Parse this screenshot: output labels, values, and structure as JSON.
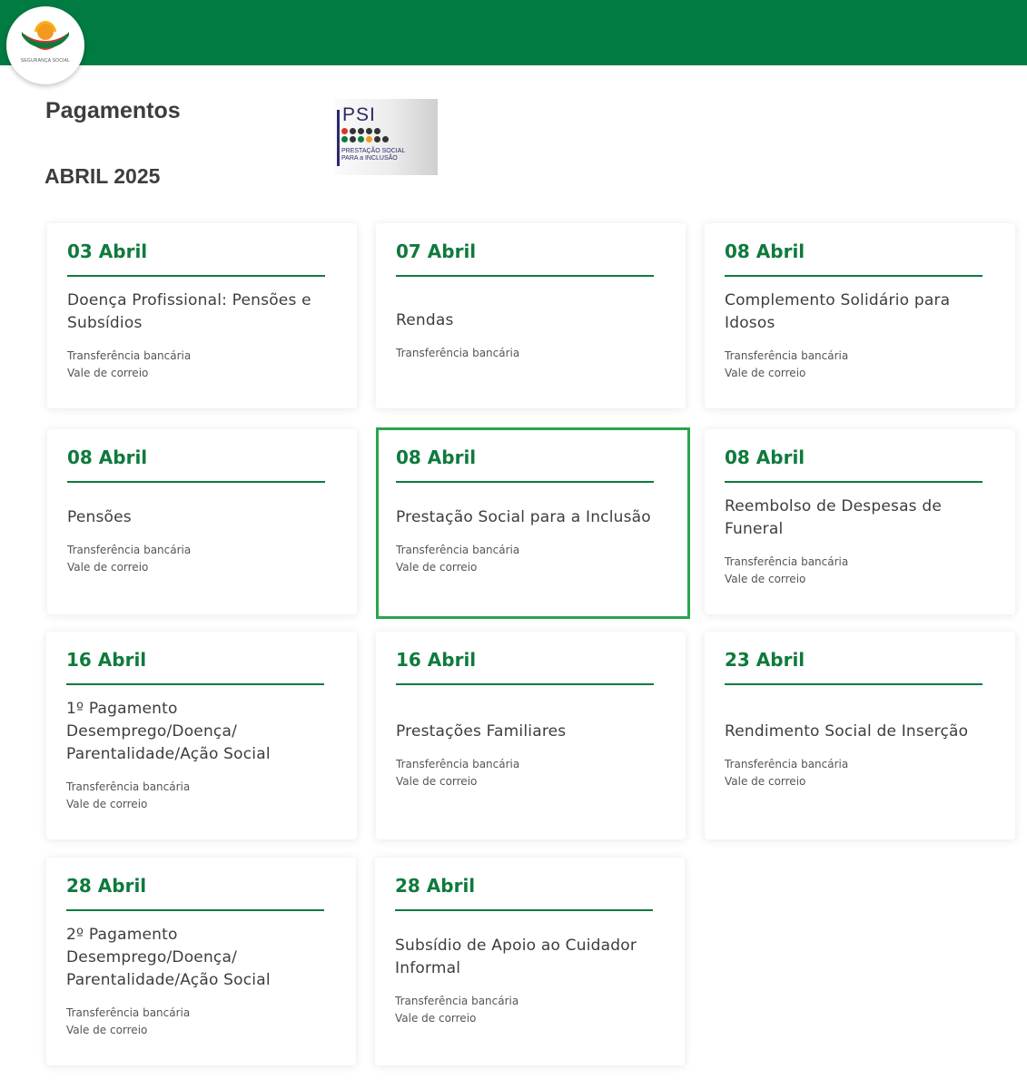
{
  "brand": {
    "logo_text": "SEGURANÇA SOCIAL",
    "color": "#007c43"
  },
  "header": {
    "title": "Pagamentos",
    "month": "ABRIL 2025"
  },
  "psi_badge": {
    "letters": "PSI",
    "caption_line1": "PRESTAÇÃO SOCIAL",
    "caption_line2": "PARA a INCLUSÃO"
  },
  "payments": [
    {
      "date": "03 Abril",
      "name": "Doença Profissional: Pensões e Subsídios",
      "methods": [
        "Transferência bancária",
        "Vale de correio"
      ]
    },
    {
      "date": "07 Abril",
      "name": "Rendas",
      "methods": [
        "Transferência bancária"
      ]
    },
    {
      "date": "08 Abril",
      "name": "Complemento Solidário para Idosos",
      "methods": [
        "Transferência bancária",
        "Vale de correio"
      ]
    },
    {
      "date": "08 Abril",
      "name": "Pensões",
      "methods": [
        "Transferência bancária",
        "Vale de correio"
      ]
    },
    {
      "date": "08 Abril",
      "name": "Prestação Social para a Inclusão",
      "methods": [
        "Transferência bancária",
        "Vale de correio"
      ],
      "highlighted": true
    },
    {
      "date": "08 Abril",
      "name": "Reembolso de Despesas de Funeral",
      "methods": [
        "Transferência bancária",
        "Vale de correio"
      ]
    },
    {
      "date": "16 Abril",
      "name": "1º Pagamento Desemprego/Doença/ Parentalidade/Ação Social",
      "methods": [
        "Transferência bancária",
        "Vale de correio"
      ]
    },
    {
      "date": "16 Abril",
      "name": "Prestações Familiares",
      "methods": [
        "Transferência bancária",
        "Vale de correio"
      ]
    },
    {
      "date": "23 Abril",
      "name": "Rendimento Social de Inserção",
      "methods": [
        "Transferência bancária",
        "Vale de correio"
      ]
    },
    {
      "date": "28 Abril",
      "name": "2º Pagamento Desemprego/Doença/ Parentalidade/Ação Social",
      "methods": [
        "Transferência bancária",
        "Vale de correio"
      ]
    },
    {
      "date": "28 Abril",
      "name": "Subsídio de Apoio ao Cuidador Informal",
      "methods": [
        "Transferência bancária",
        "Vale de correio"
      ]
    }
  ]
}
